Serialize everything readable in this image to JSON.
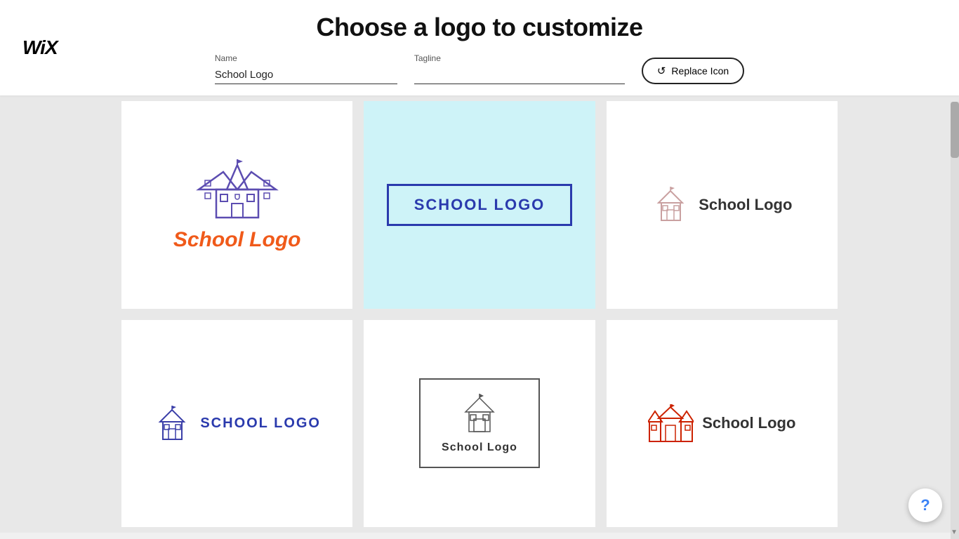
{
  "wix": {
    "logo": "WiX"
  },
  "header": {
    "title": "Choose a logo to customize",
    "name_label": "Name",
    "tagline_label": "Tagline",
    "name_value": "School Logo",
    "tagline_value": "",
    "name_placeholder": "School Logo",
    "tagline_placeholder": "",
    "replace_icon_btn": "Replace Icon"
  },
  "cards": [
    {
      "id": "card1",
      "text": "School Logo",
      "style": "orange-italic",
      "selected": false
    },
    {
      "id": "card2",
      "text": "School Logo",
      "style": "boxed-blue",
      "selected": true
    },
    {
      "id": "card3",
      "text": "School Logo",
      "style": "pink-horizontal",
      "selected": false
    },
    {
      "id": "card4",
      "text": "School Logo",
      "style": "blue-horizontal-caps",
      "selected": false
    },
    {
      "id": "card5",
      "text": "School Logo",
      "style": "boxed-minimal",
      "selected": false
    },
    {
      "id": "card6",
      "text": "School Logo",
      "style": "red-horizontal",
      "selected": false
    }
  ],
  "help_btn": "?"
}
